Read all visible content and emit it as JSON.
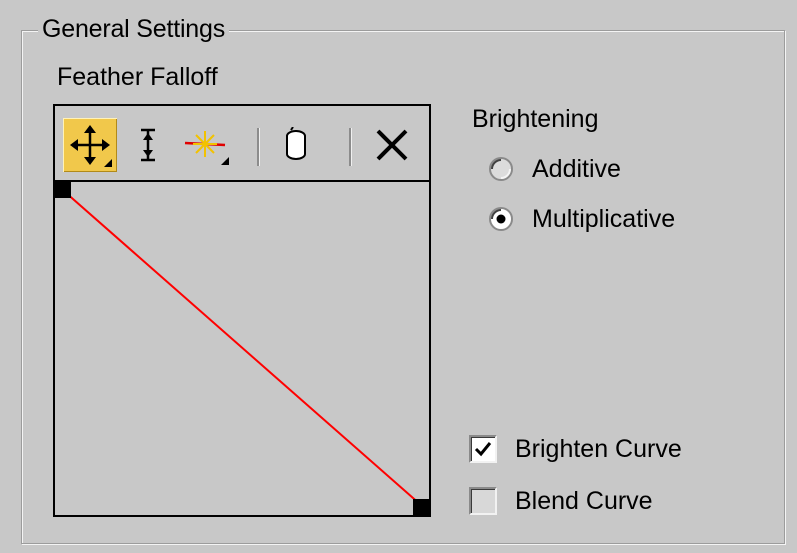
{
  "group": {
    "title": "General Settings"
  },
  "falloff": {
    "label": "Feather Falloff",
    "toolbar": {
      "move_icon": "move-arrows-icon",
      "scale_icon": "vertical-scale-icon",
      "insert_icon": "insert-point-icon",
      "reset_icon": "reset-cylinder-icon",
      "delete_icon": "delete-x-icon"
    },
    "curve_color": "#ff0000"
  },
  "brightening": {
    "label": "Brightening",
    "options": [
      {
        "label": "Additive",
        "selected": false
      },
      {
        "label": "Multiplicative",
        "selected": true
      }
    ]
  },
  "checkboxes": {
    "brighten_curve": {
      "label": "Brighten Curve",
      "checked": true
    },
    "blend_curve": {
      "label": "Blend Curve",
      "checked": false
    }
  },
  "colors": {
    "panel": "#c8c8c8",
    "active_tool": "#f1c84b"
  }
}
